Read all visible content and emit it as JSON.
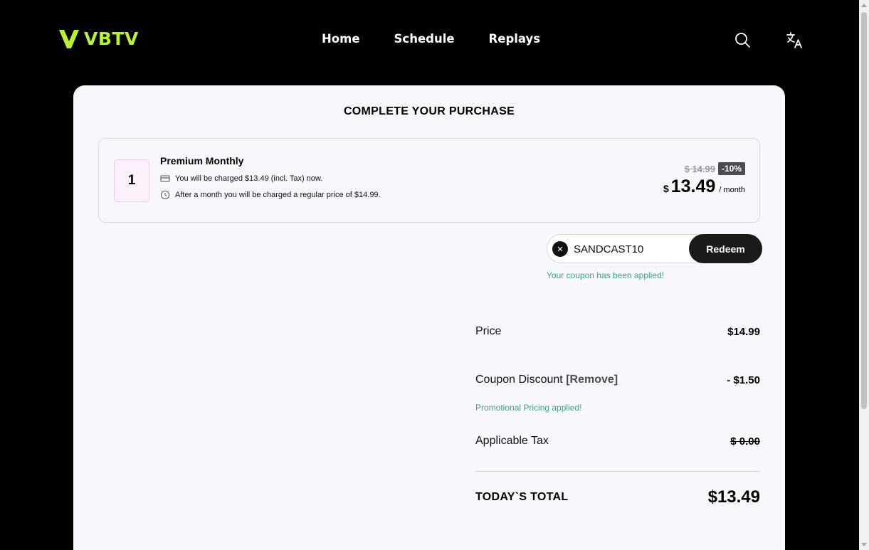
{
  "header": {
    "brand": "VBTV",
    "nav": [
      "Home",
      "Schedule",
      "Replays"
    ],
    "icons": [
      "search-icon",
      "translate-icon"
    ],
    "accent_color": "#b6f32c"
  },
  "checkout": {
    "title": "COMPLETE YOUR PURCHASE",
    "product": {
      "quantity": "1",
      "name": "Premium Monthly",
      "charge_note": "You will be charged $13.49 (incl. Tax) now.",
      "renewal_note": "After a month you will be charged a regular price of $14.99.",
      "old_price": "$ 14.99",
      "discount_badge": "-10%",
      "currency": "$",
      "price": "13.49",
      "period": "/ month"
    },
    "coupon": {
      "code": "SANDCAST10",
      "redeem_label": "Redeem",
      "success_message": "Your coupon has been applied!",
      "success_color": "#3aa679"
    },
    "summary": {
      "price_label": "Price",
      "price_value": "$14.99",
      "discount_label": "Coupon Discount",
      "remove_label": "[Remove]",
      "discount_value": "- $1.50",
      "promo_message": "Promotional Pricing applied!",
      "tax_label": "Applicable Tax",
      "tax_value": "$ 0.00",
      "total_label": "TODAY`S TOTAL",
      "total_value": "$13.49"
    }
  }
}
